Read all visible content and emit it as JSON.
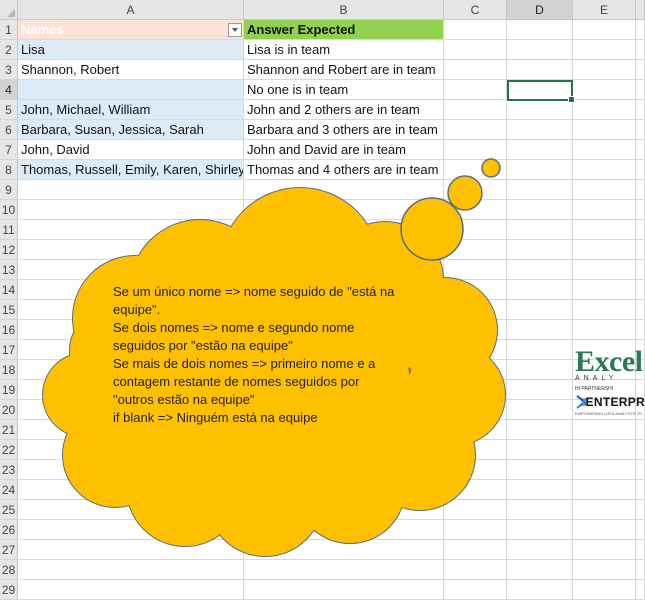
{
  "columns": [
    {
      "id": "corner",
      "label": ""
    },
    {
      "id": "A",
      "label": "A"
    },
    {
      "id": "B",
      "label": "B"
    },
    {
      "id": "C",
      "label": "C"
    },
    {
      "id": "D",
      "label": "D"
    },
    {
      "id": "E",
      "label": "E"
    }
  ],
  "rows": [
    "1",
    "2",
    "3",
    "4",
    "5",
    "6",
    "7",
    "8",
    "9",
    "10",
    "11",
    "12",
    "13",
    "14",
    "15",
    "16",
    "17",
    "18",
    "19",
    "20",
    "21",
    "22",
    "23",
    "24",
    "25",
    "26",
    "27",
    "28",
    "29"
  ],
  "table": {
    "header": {
      "names": "Names",
      "answer": "Answer Expected"
    },
    "data": [
      {
        "names": "Lisa",
        "answer": "Lisa is in team"
      },
      {
        "names": "Shannon, Robert",
        "answer": "Shannon and Robert are in team"
      },
      {
        "names": "",
        "answer": "No one is in team"
      },
      {
        "names": "John, Michael, William",
        "answer": "John and 2 others are in team"
      },
      {
        "names": "Barbara, Susan, Jessica, Sarah",
        "answer": "Barbara and 3 others are in team"
      },
      {
        "names": "John, David",
        "answer": "John and David are in team"
      },
      {
        "names": "Thomas, Russell, Emily, Karen, Shirley",
        "answer": "Thomas and 4 others are in team"
      }
    ]
  },
  "selected_cell": "D4",
  "callout": {
    "lines": [
      "Se um único nome => nome seguido de \"está na equipe\".",
      "Se dois nomes => nome e segundo nome seguidos por \"estão na equipe\"",
      "Se mais de dois nomes => primeiro nome e a contagem restante de nomes seguidos por \"outros estão na equipe\"",
      "if blank => Ninguém está na equipe"
    ],
    "fill_color": "#ffc000",
    "stroke_color": "#5a6e7f"
  },
  "logo": {
    "brand": "Excel",
    "subbrand": "ANALY",
    "partner_text": "IN PARTNERSHI",
    "enterprise": "ENTERPR",
    "tagline": "EMPOWERING DATA ANALYSTS TO"
  },
  "colors": {
    "header_a_fill": "#fbe3d6",
    "header_b_fill": "#92d050",
    "band_fill": "#ddebf7",
    "selection_border": "#217346"
  }
}
